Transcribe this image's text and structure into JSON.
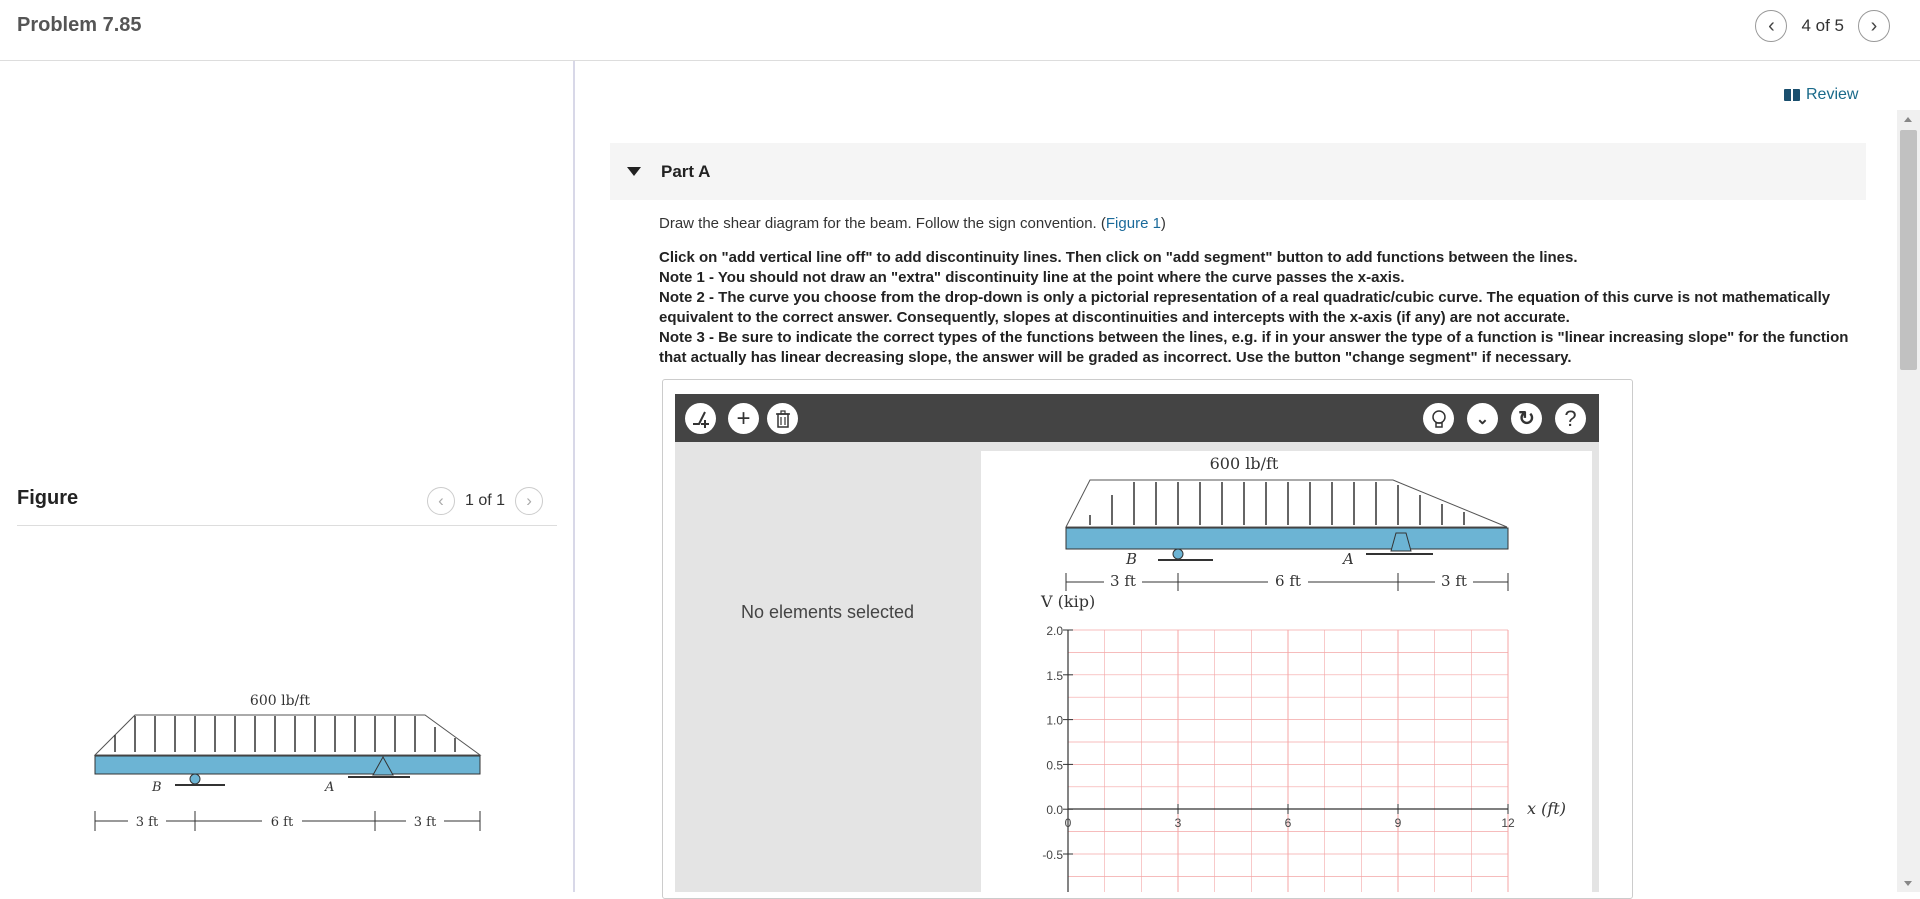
{
  "header": {
    "title": "Problem 7.85",
    "prev_icon": "chevron-left-icon",
    "next_icon": "chevron-right-icon",
    "page_count": "4 of 5"
  },
  "figure_panel": {
    "title": "Figure",
    "page_count": "1 of 1",
    "diagram": {
      "load_label": "600 lb/ft",
      "support_b": "B",
      "support_a": "A",
      "dim_1": "3 ft",
      "dim_2": "6 ft",
      "dim_3": "3 ft"
    }
  },
  "review": {
    "label": "Review",
    "icon": "book-icon"
  },
  "part": {
    "label": "Part A",
    "instruction_text": "Draw the shear diagram for the beam. Follow the sign convention. (",
    "figure_link": "Figure 1",
    "instruction_close": ")",
    "notes": [
      "Click on \"add vertical line off\" to add discontinuity lines. Then click on \"add segment\" button to add functions between the lines.",
      "Note 1 - You should not draw an \"extra\" discontinuity line at the point where the curve passes the x-axis.",
      "Note 2 - The curve you choose from the drop-down is only a pictorial representation of a real quadratic/cubic curve. The equation of this curve is not mathematically equivalent to the correct answer. Consequently, slopes at discontinuities and intercepts with the x-axis (if any) are not accurate.",
      "Note 3 - Be sure to indicate the correct types of the functions between the lines, e.g. if in your answer the type of a function is \"linear increasing slope\" for the function that actually has linear decreasing slope, the answer will be graded as incorrect. Use the button \"change segment\" if necessary."
    ]
  },
  "tool": {
    "buttons_left": [
      "add-vertical-line-icon",
      "plus-icon",
      "trash-icon"
    ],
    "buttons_right": [
      "hint-bulb-icon",
      "chevron-down-icon",
      "reset-icon",
      "help-icon"
    ],
    "help_glyph": "?",
    "status_message": "No elements selected",
    "diagram": {
      "load_label": "600 lb/ft",
      "support_b": "B",
      "support_a": "A",
      "dim_1": "3 ft",
      "dim_2": "6 ft",
      "dim_3": "3 ft"
    },
    "graph": {
      "ylabel": "V (kip)",
      "xlabel": "x (ft)",
      "y_ticks": [
        "2.0",
        "1.5",
        "1.0",
        "0.5",
        "0.0",
        "-0.5"
      ],
      "x_ticks": [
        "0",
        "3",
        "6",
        "9",
        "12"
      ],
      "grid_color": "#f4a6a6"
    }
  },
  "colors": {
    "beam_fill": "#6cb4d4",
    "link": "#1a6a9a",
    "toolbar_bg": "#444444"
  }
}
